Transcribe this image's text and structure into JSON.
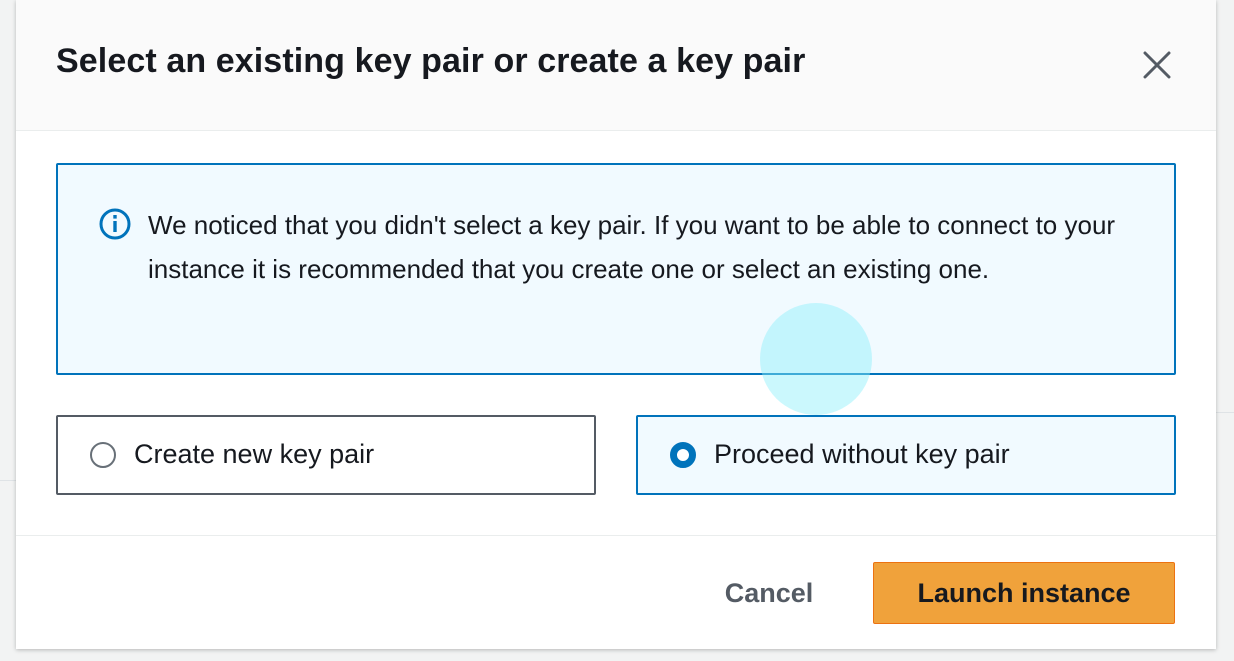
{
  "modal": {
    "title": "Select an existing key pair or create a key pair",
    "close_icon": "close-icon",
    "alert": {
      "icon": "info-icon",
      "message": "We noticed that you didn't select a key pair. If you want to be able to connect to your instance it is recommended that you create one or select an existing one."
    },
    "options": [
      {
        "label": "Create new key pair",
        "selected": false
      },
      {
        "label": "Proceed without key pair",
        "selected": true
      }
    ],
    "footer": {
      "cancel_label": "Cancel",
      "launch_label": "Launch instance"
    }
  },
  "colors": {
    "accent_blue": "#0073bb",
    "primary_orange": "#f0a23b",
    "alert_bg": "#f1faff",
    "text": "#16191f"
  }
}
